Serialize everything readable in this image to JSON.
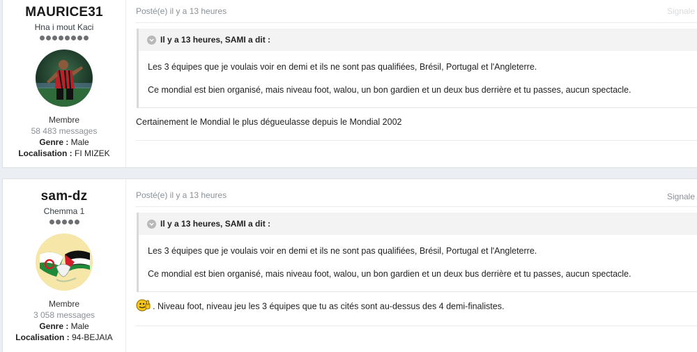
{
  "posts": [
    {
      "author": {
        "name": "MAURICE31",
        "title": "Hna i mout Kaci",
        "pips": 8,
        "group": "Membre",
        "messages": "58 483 messages",
        "genre_label": "Genre :",
        "genre_value": "Male",
        "location_label": "Localisation :",
        "location_value": "FI MIZEK"
      },
      "posted": "Posté(e) il y a 13 heures",
      "report": "Signale",
      "quote": {
        "header": "Il y a 13 heures, SAMI a dit :",
        "paragraphs": [
          "Les 3 équipes que je voulais voir en demi et ils ne sont pas qualifiées, Brésil, Portugal et l'Angleterre.",
          "Ce mondial est bien organisé, mais niveau foot, walou,  un bon gardien et un deux bus derrière et tu passes, aucun spectacle."
        ]
      },
      "reply": "Certainement le Mondial le plus dégueulasse depuis le Mondial 2002"
    },
    {
      "author": {
        "name": "sam-dz",
        "title": "Chemma 1",
        "pips": 5,
        "group": "Membre",
        "messages": "3 058 messages",
        "genre_label": "Genre :",
        "genre_value": "Male",
        "location_label": "Localisation :",
        "location_value": "94-BEJAIA"
      },
      "posted": "Posté(e) il y a 13 heures",
      "report": "Signale",
      "quote": {
        "header": "Il y a 13 heures, SAMI a dit :",
        "paragraphs": [
          "Les 3 équipes que je voulais voir en demi et ils ne sont pas qualifiées, Brésil, Portugal et l'Angleterre.",
          "Ce mondial est bien organisé, mais niveau foot, walou,  un bon gardien et un deux bus derrière et tu passes, aucun spectacle."
        ]
      },
      "reply": ". Niveau foot, niveau jeu les 3 équipes que tu as cités sont au-dessus des 4 demi-finalistes."
    }
  ],
  "colors": {
    "background": "#ebeef2",
    "card": "#ffffff",
    "muted_text": "#8a9096",
    "quote_header_bg": "#f3f3f3"
  },
  "icons": {
    "quote": "chevron-down-icon",
    "reply_smiley": "thumbs-up-smiley-icon"
  }
}
